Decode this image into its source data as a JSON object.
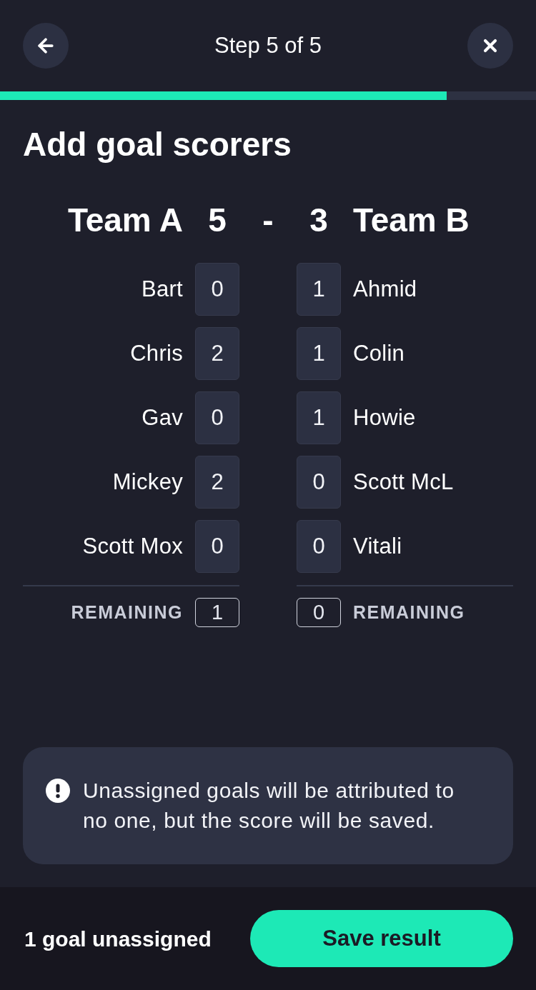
{
  "header": {
    "title": "Step 5 of 5"
  },
  "progress": {
    "level": 0.833
  },
  "heading": "Add goal scorers",
  "separator": "-",
  "teams": [
    {
      "name": "Team A",
      "score": "5",
      "players": [
        {
          "name": "Bart",
          "goals": "0"
        },
        {
          "name": "Chris",
          "goals": "2"
        },
        {
          "name": "Gav",
          "goals": "0"
        },
        {
          "name": "Mickey",
          "goals": "2"
        },
        {
          "name": "Scott Mox",
          "goals": "0"
        }
      ],
      "remaining_label": "REMAINING",
      "remaining": "1"
    },
    {
      "name": "Team B",
      "score": "3",
      "players": [
        {
          "name": "Ahmid",
          "goals": "1"
        },
        {
          "name": "Colin",
          "goals": "1"
        },
        {
          "name": "Howie",
          "goals": "1"
        },
        {
          "name": "Scott McL",
          "goals": "0"
        },
        {
          "name": "Vitali",
          "goals": "0"
        }
      ],
      "remaining_label": "REMAINING",
      "remaining": "0"
    }
  ],
  "notice": {
    "text": "Unassigned goals will be attributed to no one, but the score will be saved."
  },
  "footer": {
    "status": "1 goal unassigned",
    "button": "Save result"
  }
}
